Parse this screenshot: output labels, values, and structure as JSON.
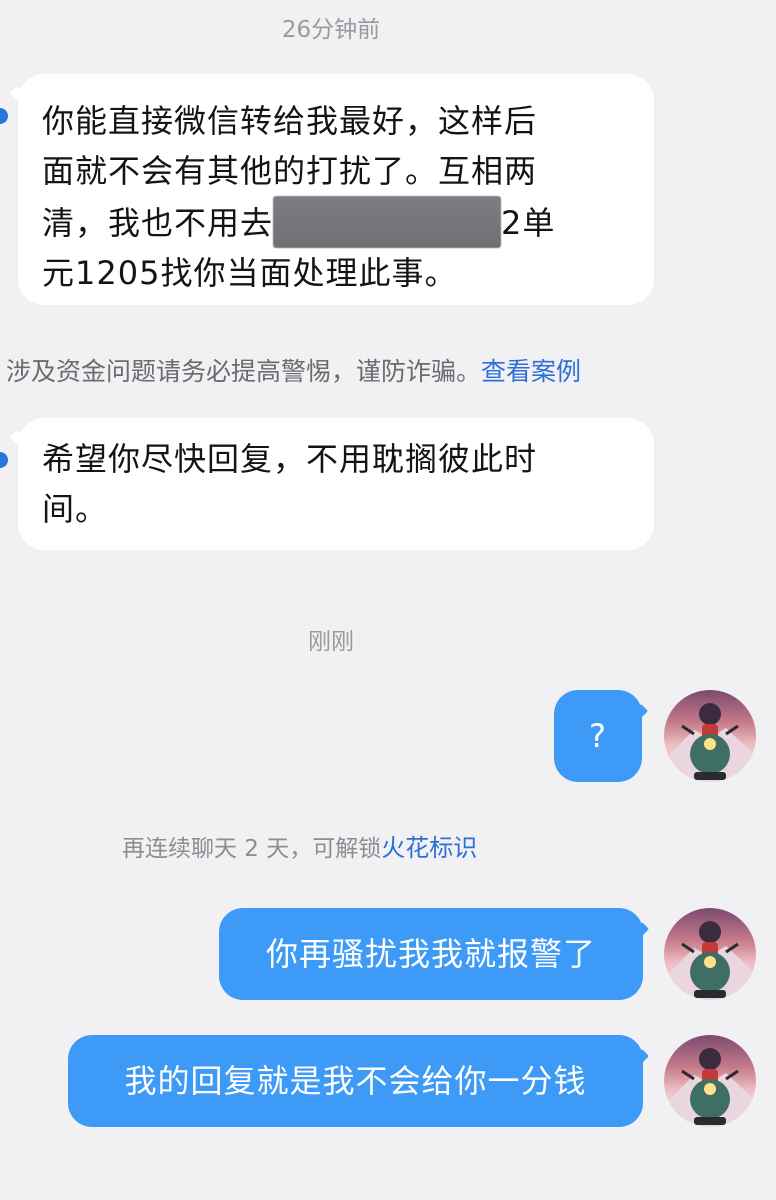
{
  "timestamps": {
    "first": "26分钟前",
    "second": "刚刚"
  },
  "messages_in": [
    {
      "line1": "你能直接微信转给我最好，这样后",
      "line2": "面就不会有其他的打扰了。互相两",
      "line3_pre": "清，我也不用去",
      "line3_post": "2单",
      "line4": "元1205找你当面处理此事。"
    },
    {
      "line1": "希望你尽快回复，不用耽搁彼此时",
      "line2": "间。"
    }
  ],
  "warning": {
    "text": "涉及资金问题请务必提高警惕，谨防诈骗。",
    "link": "查看案例"
  },
  "messages_out": [
    {
      "text": "?"
    },
    {
      "text": "你再骚扰我我就报警了"
    },
    {
      "text": "我的回复就是我不会给你一分钱"
    }
  ],
  "streak_hint": {
    "text": "再连续聊天 2 天，可解锁",
    "link": "火花标识"
  },
  "colors": {
    "background": "#f1f1f3",
    "outgoing_bubble": "#3d9af6",
    "incoming_bubble": "#ffffff",
    "link": "#2e6fd6"
  }
}
